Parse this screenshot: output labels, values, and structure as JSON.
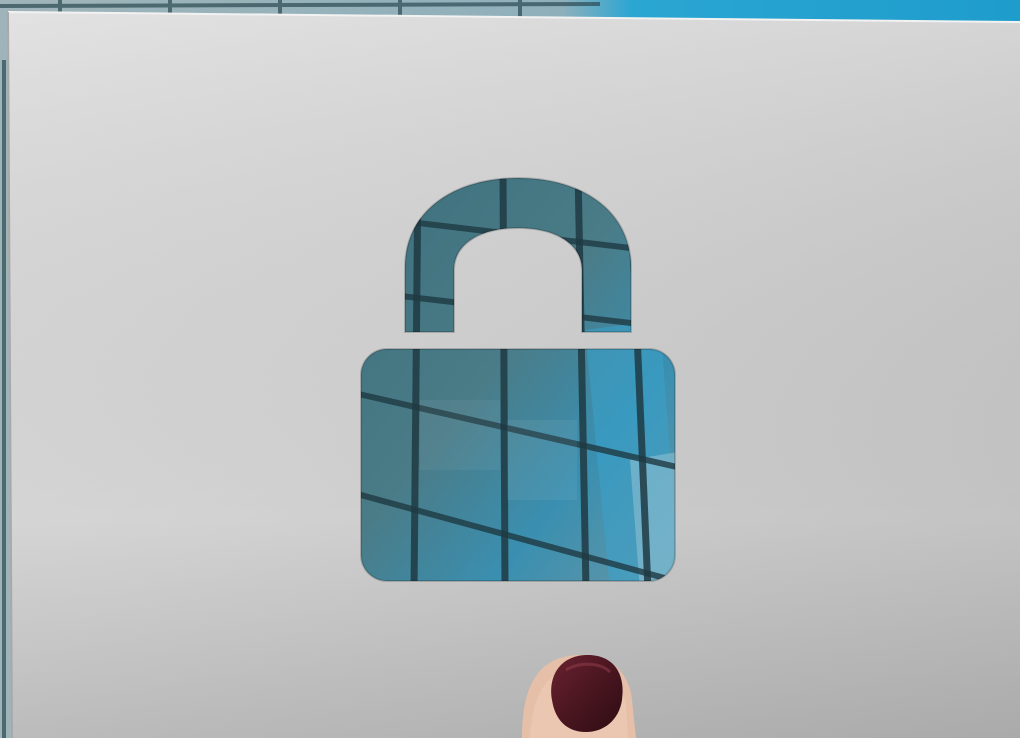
{
  "scene": {
    "subject": "padlock-cutout",
    "colors": {
      "paper_light": "#dcdcdc",
      "paper_mid": "#c9c9c9",
      "paper_shadow": "#b4b4b4",
      "sky_blue": "#2ba6d3",
      "glass_teal": "#4f7f8c",
      "glass_dark": "#244d58",
      "window_frame": "#1f3a43",
      "nail_polish": "#4a1620",
      "skin": "#e9c6b0"
    }
  }
}
